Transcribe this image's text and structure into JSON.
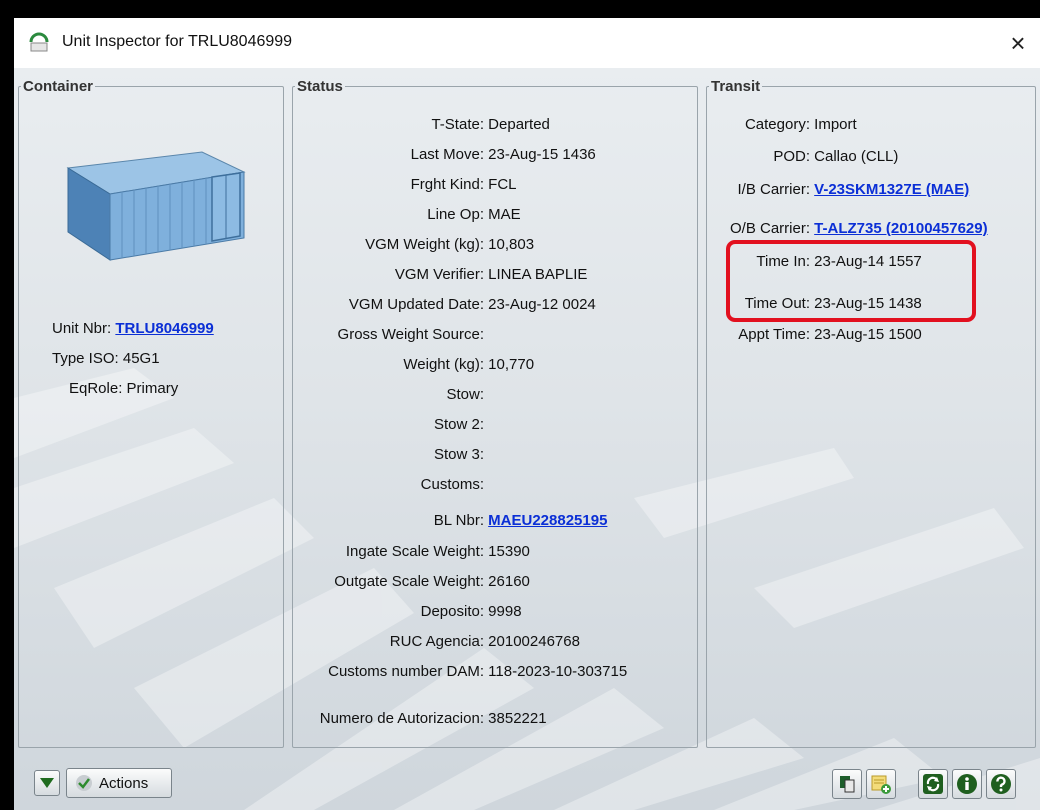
{
  "window": {
    "title": "Unit Inspector for TRLU8046999",
    "close_glyph": "×"
  },
  "container": {
    "legend": "Container",
    "fields": [
      {
        "label": "Unit Nbr:",
        "value": "TRLU8046999",
        "link": true
      },
      {
        "label": "Type ISO:",
        "value": "45G1"
      },
      {
        "label": "EqRole:",
        "value": "Primary"
      }
    ]
  },
  "status": {
    "legend": "Status",
    "fields": [
      {
        "label": "T-State:",
        "value": "Departed"
      },
      {
        "label": "Last Move:",
        "value": "23-Aug-15 1436"
      },
      {
        "label": "Frght Kind:",
        "value": "FCL"
      },
      {
        "label": "Line Op:",
        "value": "MAE"
      },
      {
        "label": "VGM Weight (kg):",
        "value": "10,803"
      },
      {
        "label": "VGM Verifier:",
        "value": "LINEA BAPLIE"
      },
      {
        "label": "VGM Updated Date:",
        "value": "23-Aug-12 0024"
      },
      {
        "label": "Gross Weight Source:",
        "value": ""
      },
      {
        "label": "Weight (kg):",
        "value": "10,770"
      },
      {
        "label": "Stow:",
        "value": ""
      },
      {
        "label": "Stow 2:",
        "value": ""
      },
      {
        "label": "Stow 3:",
        "value": ""
      },
      {
        "label": "Customs:",
        "value": ""
      },
      {
        "label": "BL Nbr:",
        "value": "MAEU228825195",
        "link": true
      },
      {
        "label": "Ingate Scale Weight:",
        "value": "15390"
      },
      {
        "label": "Outgate Scale Weight:",
        "value": "26160"
      },
      {
        "label": "Deposito:",
        "value": "9998"
      },
      {
        "label": "RUC Agencia:",
        "value": "20100246768"
      },
      {
        "label": "Customs number DAM:",
        "value": "118-2023-10-303715"
      },
      {
        "label": "Numero de Autorizacion:",
        "value": "3852221"
      }
    ]
  },
  "transit": {
    "legend": "Transit",
    "fields": [
      {
        "label": "Category:",
        "value": "Import"
      },
      {
        "label": "POD:",
        "value": "Callao (CLL)"
      },
      {
        "label": "I/B Carrier:",
        "value": "V-23SKM1327E (MAE)",
        "link": true
      },
      {
        "label": "O/B Carrier:",
        "value": "T-ALZ735 (20100457629)",
        "link": true
      },
      {
        "label": "Time In:",
        "value": "23-Aug-14 1557"
      },
      {
        "label": "Time Out:",
        "value": "23-Aug-15 1438"
      },
      {
        "label": "Appt Time:",
        "value": "23-Aug-15 1500"
      }
    ]
  },
  "toolbar": {
    "actions_label": "Actions",
    "icons": [
      "expand-down-icon",
      "check-icon",
      "copy-icon",
      "add-note-icon",
      "refresh-icon",
      "info-icon",
      "help-icon"
    ]
  },
  "colors": {
    "link": "#0b2fd6",
    "highlight": "#e2101f",
    "panel_border": "#9aa4ab"
  }
}
